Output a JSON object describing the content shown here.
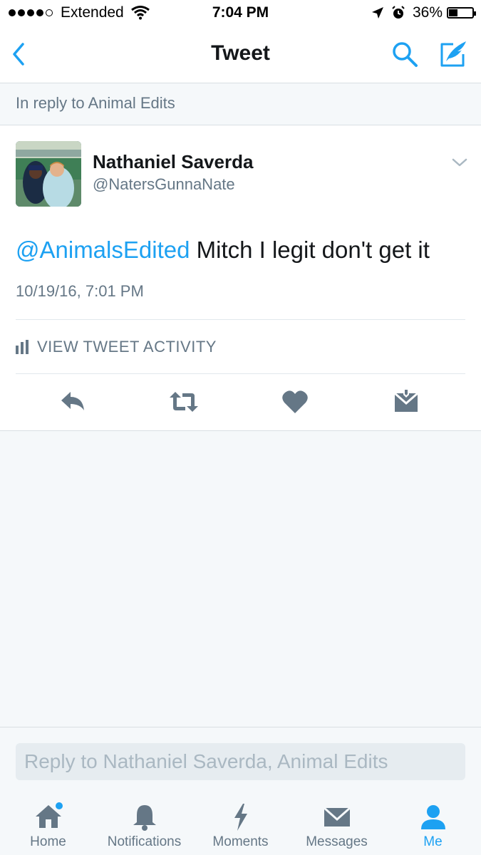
{
  "status_bar": {
    "carrier": "Extended",
    "time": "7:04 PM",
    "battery": "36%",
    "battery_level": 0.36
  },
  "nav": {
    "title": "Tweet"
  },
  "reply_context": "In reply to Animal Edits",
  "tweet": {
    "user_name": "Nathaniel Saverda",
    "handle": "@NatersGunnaNate",
    "mention": "@AnimalsEdited",
    "text": " Mitch I legit don't get it",
    "timestamp": "10/19/16, 7:01 PM",
    "activity_label": "VIEW TWEET ACTIVITY"
  },
  "reply_bar": {
    "placeholder": "Reply to Nathaniel Saverda, Animal Edits"
  },
  "tabs": [
    {
      "label": "Home",
      "icon": "home-icon"
    },
    {
      "label": "Notifications",
      "icon": "bell-icon"
    },
    {
      "label": "Moments",
      "icon": "lightning-icon"
    },
    {
      "label": "Messages",
      "icon": "envelope-icon"
    },
    {
      "label": "Me",
      "icon": "person-icon"
    }
  ],
  "colors": {
    "accent": "#1da1f2",
    "secondary_text": "#657786",
    "icon_gray": "#657786"
  }
}
